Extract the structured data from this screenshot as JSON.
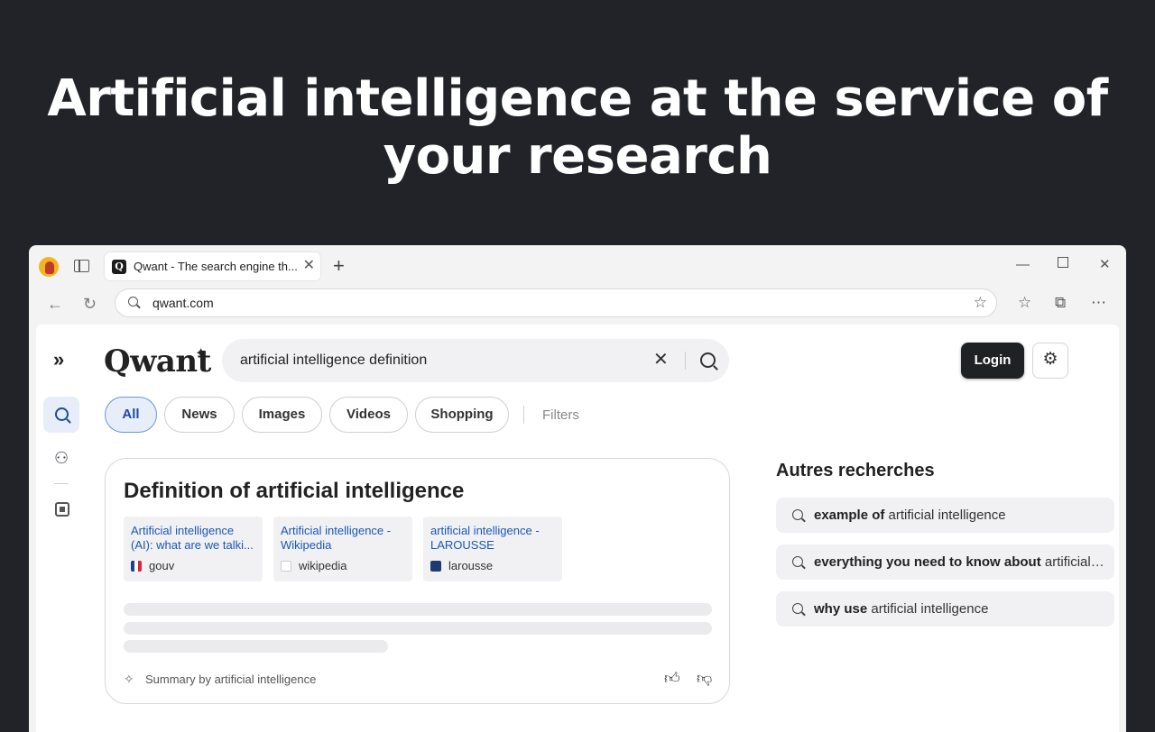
{
  "hero": {
    "line1": "Artificial intelligence at the service of",
    "line2": "your research"
  },
  "browser": {
    "tab_title": "Qwant - The search engine th...",
    "tab_favicon": "Q",
    "url": "qwant.com"
  },
  "qwant": {
    "logo": "Qwant",
    "search_query": "artificial intelligence definition",
    "login_label": "Login",
    "filters_label": "Filters",
    "tabs": [
      {
        "label": "All",
        "active": true
      },
      {
        "label": "News"
      },
      {
        "label": "Images"
      },
      {
        "label": "Videos"
      },
      {
        "label": "Shopping"
      }
    ]
  },
  "definition_card": {
    "title": "Definition of artificial intelligence",
    "sources": [
      {
        "title_line1": "Artificial intelligence",
        "title_line2": "(AI): what are we talki...",
        "site": "gouv"
      },
      {
        "title_line1": "Artificial intelligence -",
        "title_line2": "Wikipedia",
        "site": "wikipedia"
      },
      {
        "title_line1": "artificial intelligence -",
        "title_line2": "LAROUSSE",
        "site": "larousse"
      }
    ],
    "footer_label": "Summary by artificial intelligence"
  },
  "sidebar": {
    "title": "Autres recherches",
    "suggestions": [
      {
        "bold": "example of",
        "rest": " artificial intelligence"
      },
      {
        "bold": "everything you need to know about",
        "rest": " artificial intelligence"
      },
      {
        "bold": "why use",
        "rest": " artificial intelligence"
      }
    ]
  }
}
